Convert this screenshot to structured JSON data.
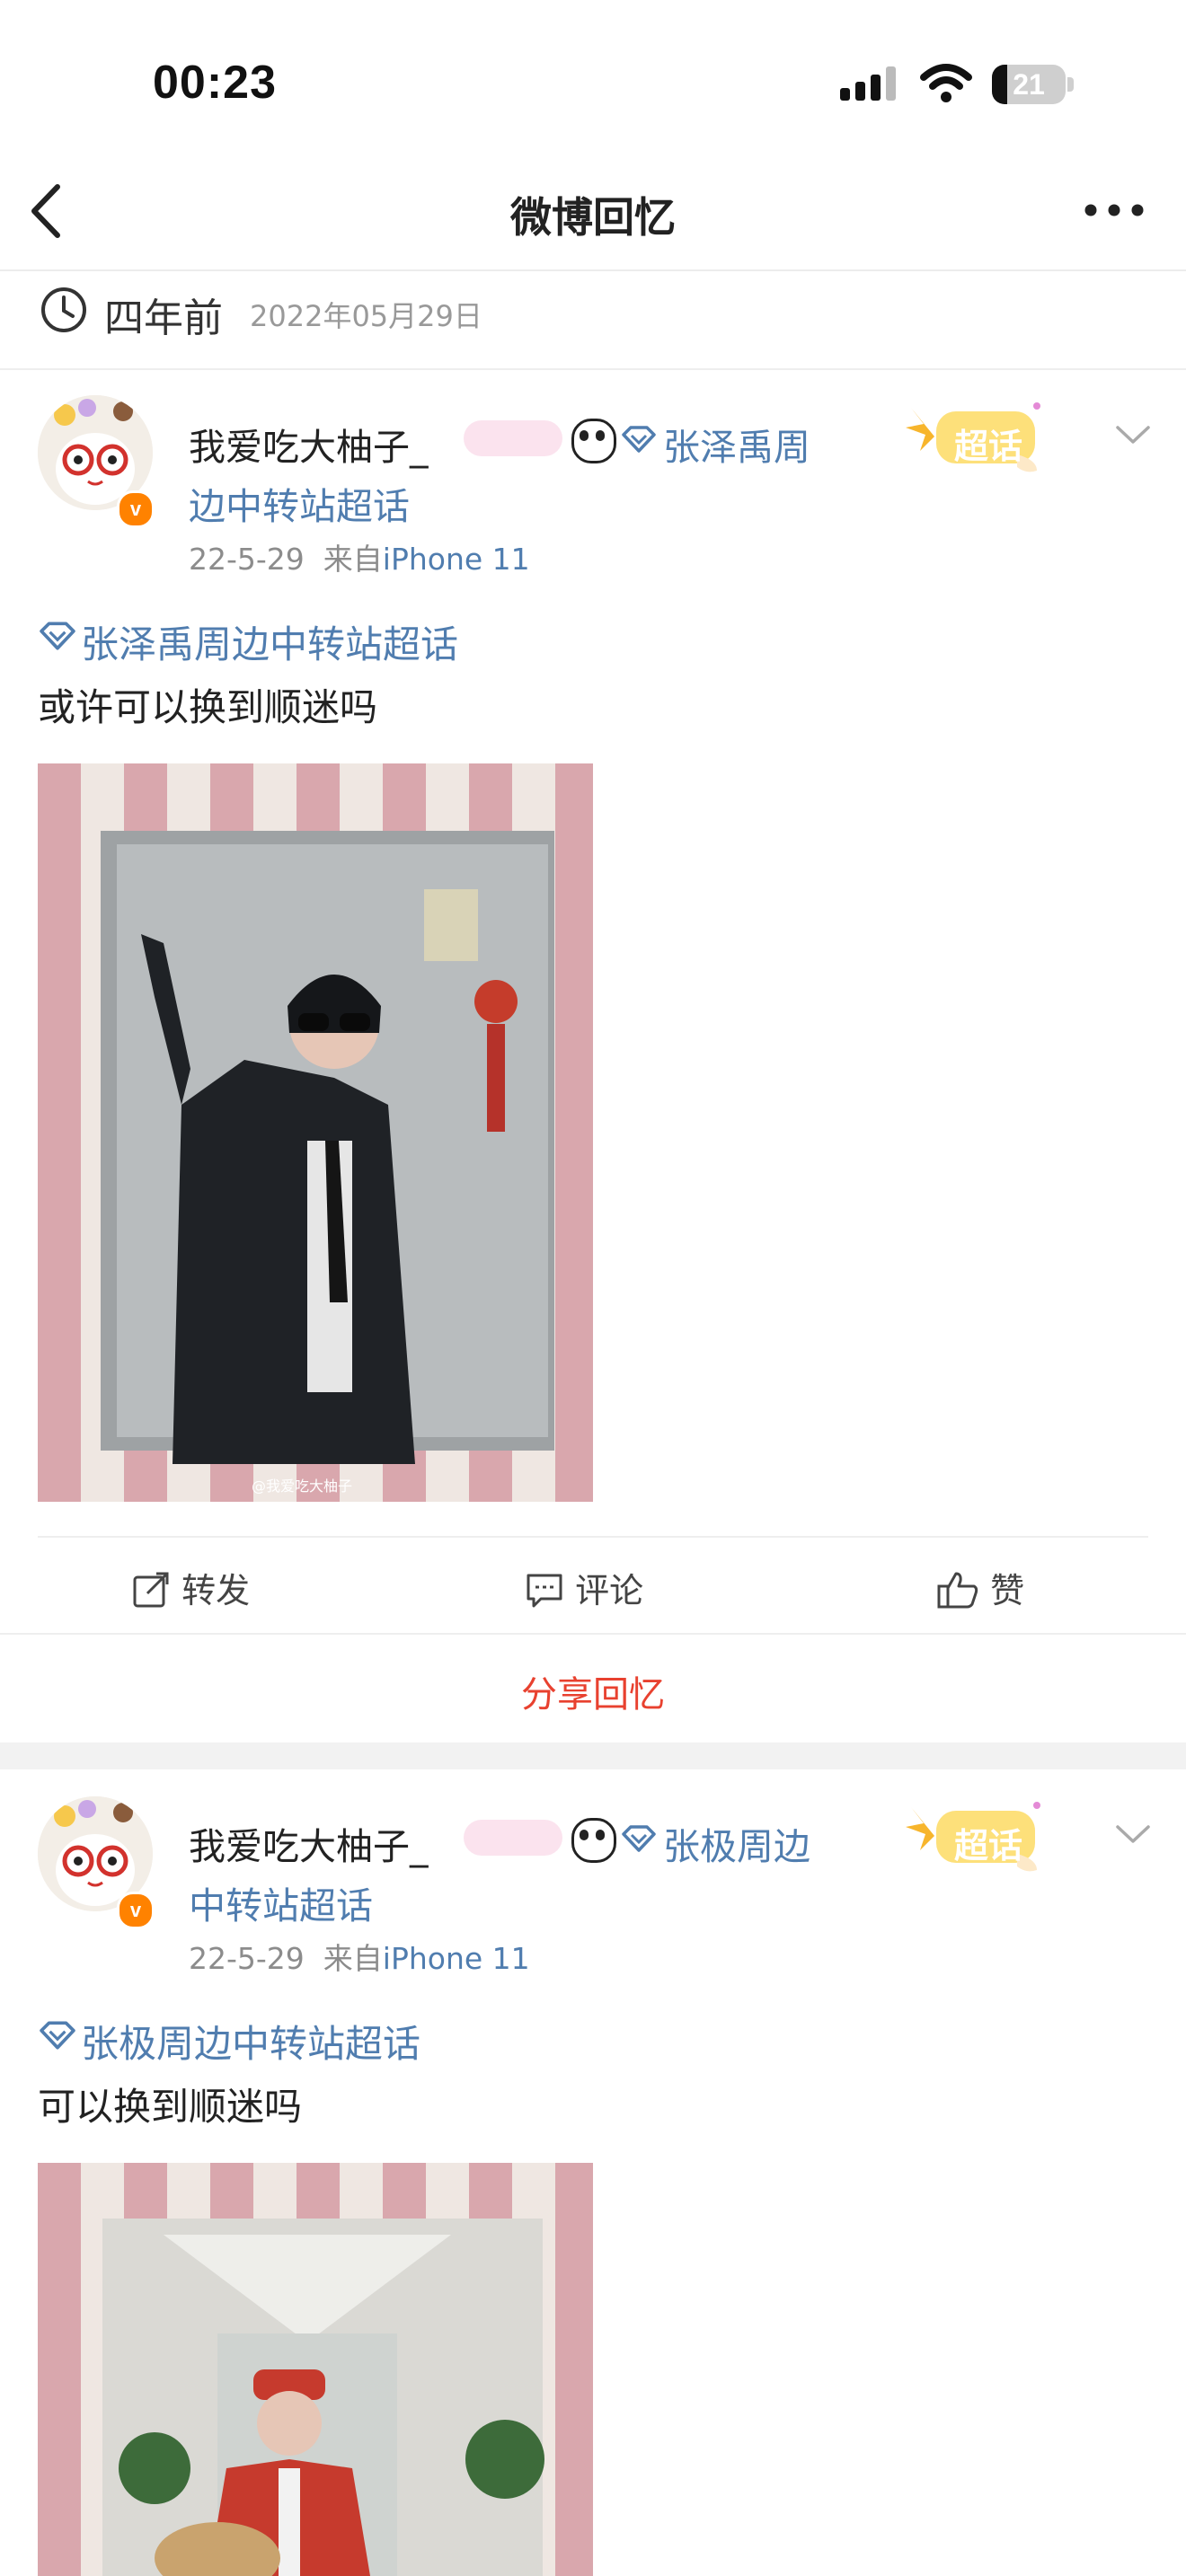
{
  "status_bar": {
    "time": "00:23",
    "battery": "21",
    "battery_level": 0.21
  },
  "nav": {
    "title": "微博回忆"
  },
  "memory": {
    "ago": "四年前",
    "date": "2022年05月29日"
  },
  "posts": [
    {
      "user": "我爱吃大柚子_",
      "supertopic_line1": "张泽禹周",
      "supertopic_line2": "边中转站超话",
      "time": "22-5-29",
      "source_prefix": "来自",
      "device": "iPhone 11",
      "tag": "张泽禹周边中转站超话",
      "text": "或许可以换到顺迷吗",
      "watermark": "@我爱吃大柚子",
      "badge": "超话",
      "actions": {
        "repost": "转发",
        "comment": "评论",
        "like": "赞"
      },
      "share": "分享回忆"
    },
    {
      "user": "我爱吃大柚子_",
      "supertopic_line1": "张极周边",
      "supertopic_line2": "中转站超话",
      "time": "22-5-29",
      "source_prefix": "来自",
      "device": "iPhone 11",
      "tag": "张极周边中转站超话",
      "text": "可以换到顺迷吗",
      "badge": "超话"
    }
  ],
  "colors": {
    "link": "#507daf",
    "share": "#e8412f",
    "verified": "#ff8200"
  },
  "icons": [
    "back-icon",
    "more-icon",
    "clock-icon",
    "diamond-icon",
    "repost-icon",
    "comment-icon",
    "like-icon",
    "chevron-down-icon",
    "signal-icon",
    "wifi-icon",
    "battery-icon"
  ]
}
